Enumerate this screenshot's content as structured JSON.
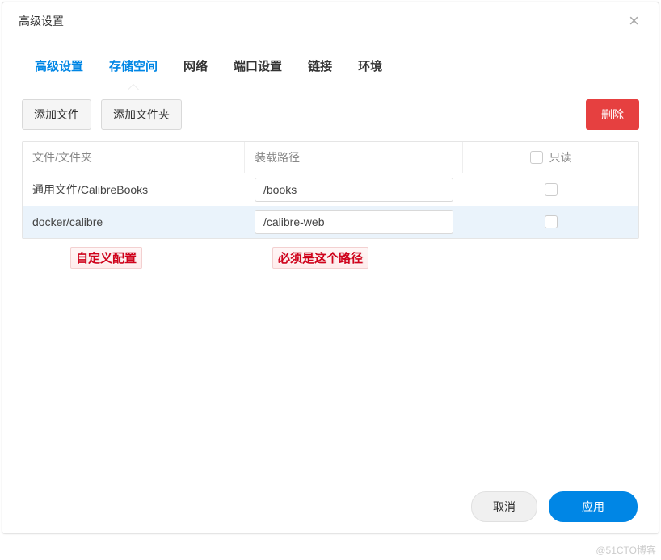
{
  "dialog": {
    "title": "高级设置"
  },
  "tabs": [
    {
      "label": "高级设置",
      "active": true
    },
    {
      "label": "存储空间",
      "active": true,
      "current": true
    },
    {
      "label": "网络"
    },
    {
      "label": "端口设置"
    },
    {
      "label": "链接"
    },
    {
      "label": "环境"
    }
  ],
  "toolbar": {
    "add_file": "添加文件",
    "add_folder": "添加文件夹",
    "delete": "删除"
  },
  "table": {
    "headers": {
      "file": "文件/文件夹",
      "path": "装载路径",
      "readonly": "只读"
    },
    "rows": [
      {
        "file": "通用文件/CalibreBooks",
        "path": "/books",
        "readonly": false,
        "highlight": false
      },
      {
        "file": "docker/calibre",
        "path": "/calibre-web",
        "readonly": false,
        "highlight": true
      }
    ]
  },
  "annotations": {
    "a1": "自定义配置",
    "a2": "必须是这个路径"
  },
  "footer": {
    "cancel": "取消",
    "apply": "应用"
  },
  "watermark": "@51CTO博客"
}
